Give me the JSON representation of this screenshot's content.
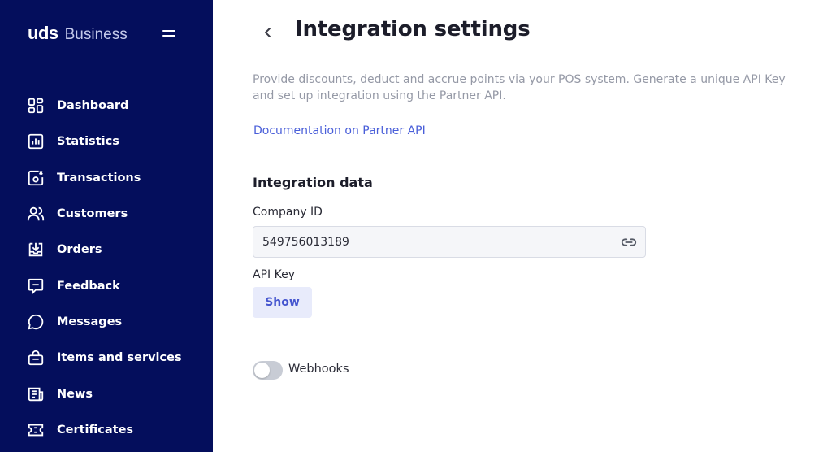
{
  "brand": {
    "name": "uds",
    "suffix": "Business"
  },
  "sidebar": {
    "items": [
      {
        "label": "Dashboard",
        "icon": "dashboard-icon"
      },
      {
        "label": "Statistics",
        "icon": "statistics-icon"
      },
      {
        "label": "Transactions",
        "icon": "transactions-icon"
      },
      {
        "label": "Customers",
        "icon": "customers-icon"
      },
      {
        "label": "Orders",
        "icon": "orders-icon"
      },
      {
        "label": "Feedback",
        "icon": "feedback-icon"
      },
      {
        "label": "Messages",
        "icon": "messages-icon"
      },
      {
        "label": "Items and services",
        "icon": "items-icon"
      },
      {
        "label": "News",
        "icon": "news-icon"
      },
      {
        "label": "Certificates",
        "icon": "certificates-icon"
      }
    ]
  },
  "page": {
    "title": "Integration settings",
    "description": "Provide discounts, deduct and accrue points via your POS system. Generate a unique API Key and set up integration using the Partner API.",
    "doc_link": "Documentation on Partner API",
    "section_title": "Integration data",
    "company_id_label": "Company ID",
    "company_id_value": "549756013189",
    "api_key_label": "API Key",
    "show_button": "Show",
    "webhooks_label": "Webhooks",
    "webhooks_enabled": false
  },
  "colors": {
    "sidebar_bg": "#040e5c",
    "accent": "#4a5fd9",
    "button_bg": "#e8ebfb",
    "text_primary": "#1c1d2a",
    "text_muted": "#9599a6"
  }
}
